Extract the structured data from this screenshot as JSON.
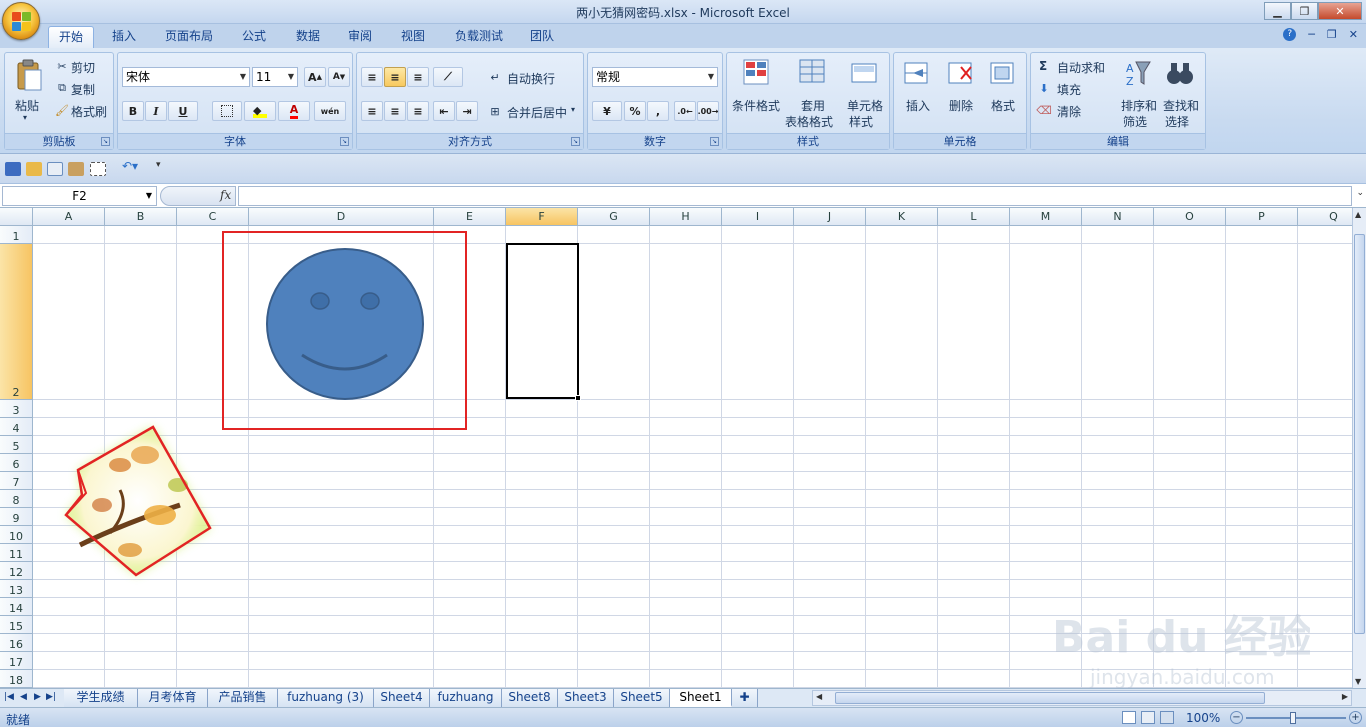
{
  "window": {
    "title": "两小无猜网密码.xlsx - Microsoft Excel"
  },
  "ribbon_tabs": [
    "开始",
    "插入",
    "页面布局",
    "公式",
    "数据",
    "审阅",
    "视图",
    "负载测试",
    "团队"
  ],
  "clipboard": {
    "paste": "粘贴",
    "cut": "剪切",
    "copy": "复制",
    "format_painter": "格式刷",
    "label": "剪贴板"
  },
  "font": {
    "name": "宋体",
    "size": "11",
    "bold": "B",
    "italic": "I",
    "underline": "U",
    "grow": "A",
    "shrink": "A",
    "phonetic": "wén",
    "label": "字体"
  },
  "alignment": {
    "wrap": "自动换行",
    "merge": "合并后居中",
    "label": "对齐方式"
  },
  "number": {
    "format": "常规",
    "percent": "%",
    "comma": ",",
    "label": "数字"
  },
  "styles": {
    "conditional": "条件格式",
    "table_line1": "套用",
    "table_line2": "表格格式",
    "cell_line1": "单元格",
    "cell_line2": "样式",
    "label": "样式"
  },
  "cells": {
    "insert": "插入",
    "delete": "删除",
    "format": "格式",
    "label": "单元格"
  },
  "editing": {
    "autosum": "自动求和",
    "fill": "填充",
    "clear": "清除",
    "sort_line1": "排序和",
    "sort_line2": "筛选",
    "find_line1": "查找和",
    "find_line2": "选择",
    "sigma": "Σ",
    "label": "编辑"
  },
  "formula_bar": {
    "name_box": "F2",
    "fx": "fx",
    "content": ""
  },
  "columns": [
    "A",
    "B",
    "C",
    "D",
    "E",
    "F",
    "G",
    "H",
    "I",
    "J",
    "K",
    "L",
    "M",
    "N",
    "O",
    "P",
    "Q"
  ],
  "selected_column": "F",
  "rows": [
    "1",
    "2",
    "3",
    "4",
    "5",
    "6",
    "7",
    "8",
    "9",
    "10",
    "11",
    "12",
    "13",
    "14",
    "15",
    "16",
    "17",
    "18"
  ],
  "selected_row": "2",
  "sheet_tabs": [
    "学生成绩",
    "月考体育",
    "产品销售",
    "fuzhuang (3)",
    "Sheet4",
    "fuzhuang",
    "Sheet8",
    "Sheet3",
    "Sheet5",
    "Sheet1"
  ],
  "active_sheet": "Sheet1",
  "status": {
    "ready": "就绪",
    "zoom": "100%"
  },
  "watermark": {
    "brand": "Bai du 经验",
    "url": "jingyan.baidu.com"
  },
  "colors": {
    "smiley_fill": "#4f81bd",
    "smiley_stroke": "#385d8a",
    "selection_red": "#e22424",
    "header_selected": "#f7c462"
  }
}
